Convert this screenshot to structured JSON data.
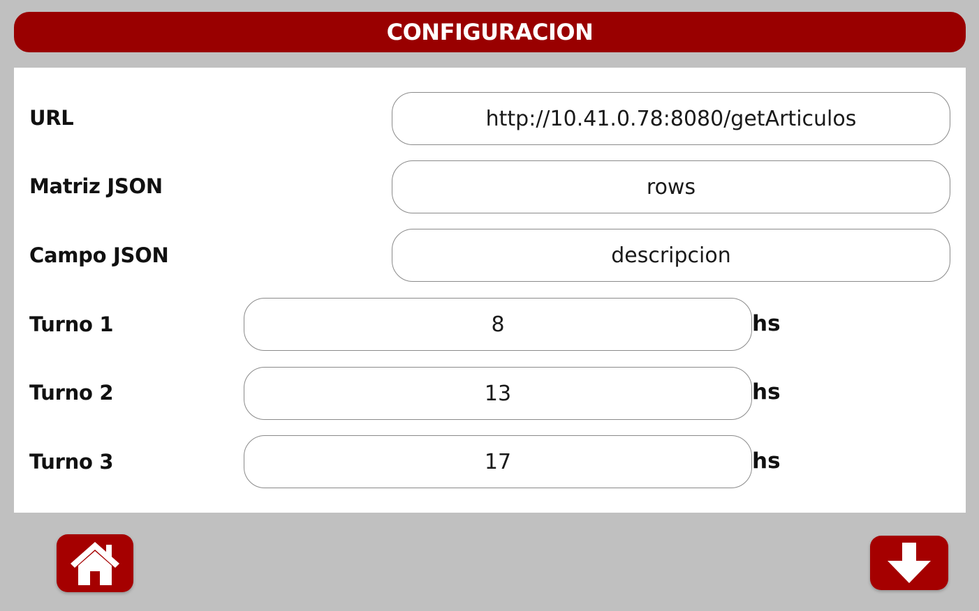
{
  "header": {
    "title": "CONFIGURACION",
    "color": "#990000"
  },
  "form": {
    "url": {
      "label": "URL",
      "value": "http://10.41.0.78:8080/getArticulos"
    },
    "matrix": {
      "label": "Matriz JSON",
      "value": "rows"
    },
    "field": {
      "label": "Campo JSON",
      "value": "descripcion"
    },
    "shift1": {
      "label": "Turno 1",
      "value": "8",
      "unit": "hs"
    },
    "shift2": {
      "label": "Turno 2",
      "value": "13",
      "unit": "hs"
    },
    "shift3": {
      "label": "Turno 3",
      "value": "17",
      "unit": "hs"
    }
  },
  "footer": {
    "home_icon": "home-icon",
    "save_icon": "arrow-down-icon",
    "button_color": "#a50000"
  }
}
